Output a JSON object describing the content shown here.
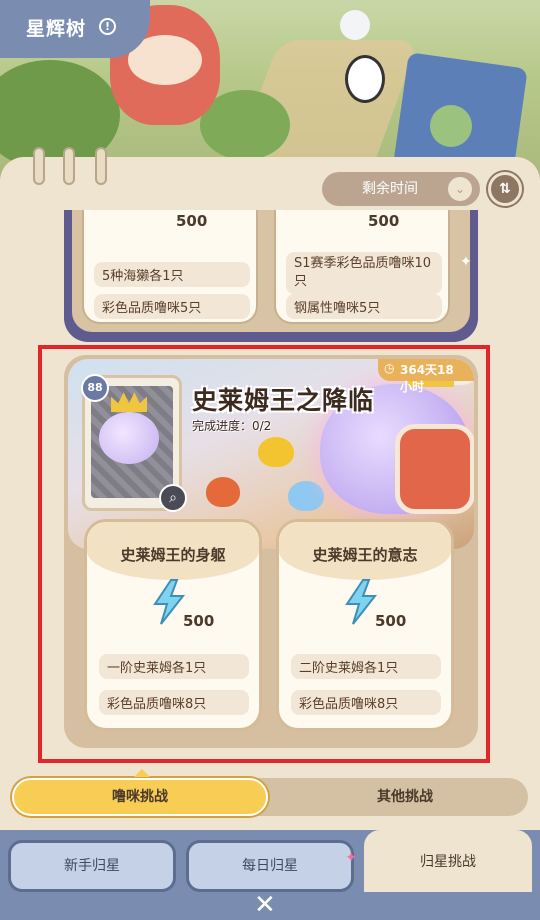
{
  "header": {
    "title": "星辉树",
    "info_icon": "!"
  },
  "filter": {
    "label": "剩余时间",
    "sort_icon": "sort-icon"
  },
  "upper_card": {
    "left": {
      "points": "500",
      "rows": [
        "5种海獭各1只",
        "彩色品质噜咪5只"
      ]
    },
    "right": {
      "points": "500",
      "rows": [
        "S1赛季彩色品质噜咪10只",
        "钢属性噜咪5只"
      ]
    }
  },
  "challenge": {
    "title": "史莱姆王之降临",
    "progress": "完成进度：0/2",
    "time_badge": "364天18小时",
    "level": "88",
    "subs": [
      {
        "name": "史莱姆王的身躯",
        "points": "500",
        "rows": [
          "一阶史莱姆各1只",
          "彩色品质噜咪8只"
        ]
      },
      {
        "name": "史莱姆王的意志",
        "points": "500",
        "rows": [
          "二阶史莱姆各1只",
          "彩色品质噜咪8只"
        ]
      }
    ]
  },
  "toggle": {
    "active": "噜咪挑战",
    "inactive": "其他挑战"
  },
  "nav": {
    "tabs": [
      "新手归星",
      "每日归星",
      "归星挑战"
    ],
    "close_icon": "close-icon"
  },
  "colors": {
    "highlight": "#e0262a",
    "accent": "#f8cd54",
    "nav_bg": "#7a8db0",
    "panel_bg": "#efe4d0"
  }
}
